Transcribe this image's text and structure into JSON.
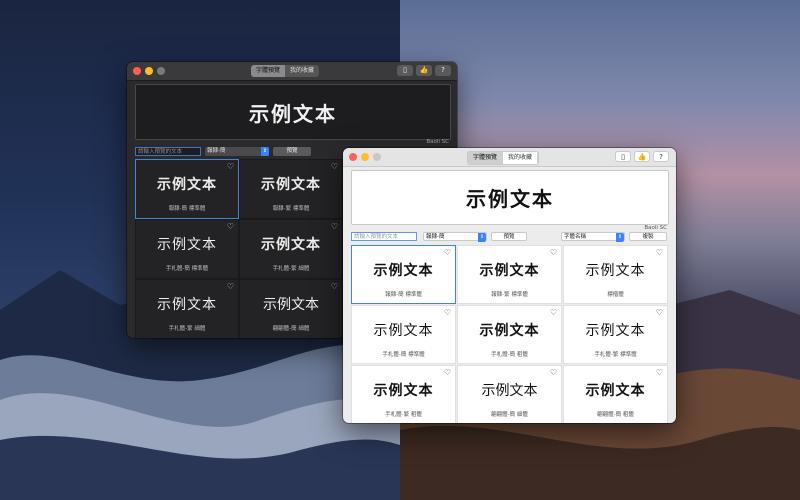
{
  "colors": {
    "traffic_red": "#ff5f57",
    "traffic_yellow": "#febc2e",
    "traffic_gray": "#7a7a7a",
    "selection_blue": "#3d86d8"
  },
  "dark_window": {
    "tabs": [
      {
        "label": "字體預覽",
        "active": true
      },
      {
        "label": "我的收藏",
        "active": false
      }
    ],
    "toolbar_icons": [
      "phone-icon",
      "thumbs-up-icon",
      "help-icon"
    ],
    "preview_text": "示例文本",
    "font_name": "Baoli SC",
    "search_placeholder": "請輸入預覽的文本",
    "select_value": "報隸-簡",
    "preview_button": "預覽",
    "cards": [
      {
        "caption": "報隸-簡 標準體",
        "style": "s-serif",
        "selected": true
      },
      {
        "caption": "報隸-繁 標準體",
        "style": "s-serif",
        "selected": false
      },
      {
        "caption": "",
        "style": "s-serif",
        "selected": false
      },
      {
        "caption": "手札體-簡 標準體",
        "style": "s-sans",
        "selected": false
      },
      {
        "caption": "手札體-繁 細體",
        "style": "s-bold",
        "selected": false
      },
      {
        "caption": "",
        "style": "s-sans",
        "selected": false
      },
      {
        "caption": "手札體-繁 細體",
        "style": "s-sans",
        "selected": false
      },
      {
        "caption": "翩翩體-簡 細體",
        "style": "s-thin",
        "selected": false
      },
      {
        "caption": "",
        "style": "s-sans",
        "selected": false
      }
    ]
  },
  "light_window": {
    "tabs": [
      {
        "label": "字體預覽",
        "active": true
      },
      {
        "label": "我的收藏",
        "active": false
      }
    ],
    "toolbar_icons": [
      "phone-icon",
      "thumbs-up-icon",
      "help-icon"
    ],
    "preview_text": "示例文本",
    "font_name": "Baoli SC",
    "search_placeholder": "請輸入預覽的文本",
    "select_value": "報隸-簡",
    "preview_button": "預覽",
    "name_select_value": "字體名稱",
    "copy_button": "複製",
    "cards": [
      {
        "caption": "報隸-簡 標準體",
        "style": "s-serif",
        "selected": true
      },
      {
        "caption": "報隸-繁 標準體",
        "style": "s-serif",
        "selected": false
      },
      {
        "caption": "標楷體",
        "style": "s-sans",
        "selected": false
      },
      {
        "caption": "手札體-簡 標準體",
        "style": "s-sans",
        "selected": false
      },
      {
        "caption": "手札體-簡 粗體",
        "style": "s-bold",
        "selected": false
      },
      {
        "caption": "手札體-繁 標準體",
        "style": "s-sans",
        "selected": false
      },
      {
        "caption": "手札體-繁 粗體",
        "style": "s-bold",
        "selected": false
      },
      {
        "caption": "翩翩體-簡 細體",
        "style": "s-thin",
        "selected": false
      },
      {
        "caption": "翩翩體-簡 粗體",
        "style": "s-bold",
        "selected": false
      }
    ]
  },
  "sample_text": "示例文本"
}
